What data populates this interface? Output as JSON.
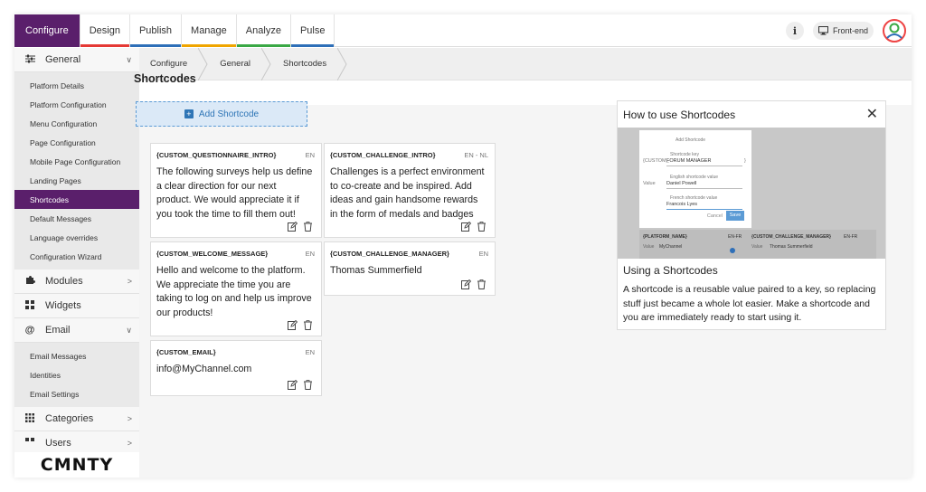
{
  "topnav": {
    "tabs": [
      {
        "label": "Configure",
        "accent": "#5a1f6b"
      },
      {
        "label": "Design",
        "accent": "#e53935"
      },
      {
        "label": "Publish",
        "accent": "#2e6fb8"
      },
      {
        "label": "Manage",
        "accent": "#f0a500"
      },
      {
        "label": "Analyze",
        "accent": "#3aa845"
      },
      {
        "label": "Pulse",
        "accent": "#2e6fb8"
      }
    ],
    "info_icon": "i",
    "frontend_label": "Front-end"
  },
  "sidebar": {
    "general": {
      "label": "General",
      "icon": "sliders-icon",
      "chevron": "∨"
    },
    "general_items": [
      "Platform Details",
      "Platform Configuration",
      "Menu Configuration",
      "Page Configuration",
      "Mobile Page Configuration",
      "Landing Pages",
      "Shortcodes",
      "Default Messages",
      "Language overrides",
      "Configuration Wizard"
    ],
    "modules": {
      "label": "Modules",
      "chevron": ">"
    },
    "widgets": {
      "label": "Widgets"
    },
    "email": {
      "label": "Email",
      "chevron": "∨"
    },
    "email_items": [
      "Email Messages",
      "Identities",
      "Email Settings"
    ],
    "categories": {
      "label": "Categories",
      "chevron": ">"
    },
    "users": {
      "label": "Users",
      "chevron": ">"
    },
    "logo": "CMNTY"
  },
  "breadcrumb": [
    "Configure",
    "General",
    "Shortcodes"
  ],
  "page_title": "Shortcodes",
  "add_button": "Add Shortcode",
  "cards": [
    {
      "key": "{CUSTOM_QUESTIONNAIRE_INTRO}",
      "lang": "EN",
      "value": "The following surveys help us define a clear direction for our next product. We would appreciate it if you took the time to fill them out!"
    },
    {
      "key": "{CUSTOM_WELCOME_MESSAGE}",
      "lang": "EN",
      "value": "Hello and welcome to the platform. We appreciate the time you are taking to log on and help us improve our products!"
    },
    {
      "key": "{CUSTOM_EMAIL}",
      "lang": "EN",
      "value": "info@MyChannel.com"
    },
    {
      "key": "{CUSTOM_CHALLENGE_INTRO}",
      "lang": "EN - NL",
      "value": "Challenges is a perfect environment to co-create and be inspired. Add ideas and gain handsome rewards in the form of medals and badges"
    },
    {
      "key": "{CUSTOM_CHALLENGE_MANAGER}",
      "lang": "EN",
      "value": "Thomas Summerfield"
    }
  ],
  "help": {
    "title": "How to use Shortcodes",
    "subtitle": "Using a Shortcodes",
    "description": "A shortcode is a reusable value paired to a key, so replacing stuff just became a whole lot easier. Make a shortcode and you are immediately ready to start using it.",
    "preview": {
      "add_label": "Add Shortcode",
      "key_caption": "Shortcode key",
      "key_prefix": "{CUSTOM_",
      "key_value": "FORUM MANAGER",
      "key_suffix": "}",
      "value_label": "Value",
      "en_caption": "English shortcode value",
      "en_value": "Daniel Powell",
      "fr_caption": "French shortcode value",
      "fr_value": "Francois Lyes",
      "cancel": "Cancel",
      "save": "Save",
      "row1_key": "{PLATFORM_NAME}",
      "row1_lang": "EN-FR",
      "row1_value_label": "Value",
      "row1_value": "MyChannel",
      "row2_key": "{CUSTOM_CHALLENGE_MANAGER}",
      "row2_lang": "EN-FR",
      "row2_value_label": "Value",
      "row2_value": "Thomas Summerfield"
    }
  }
}
